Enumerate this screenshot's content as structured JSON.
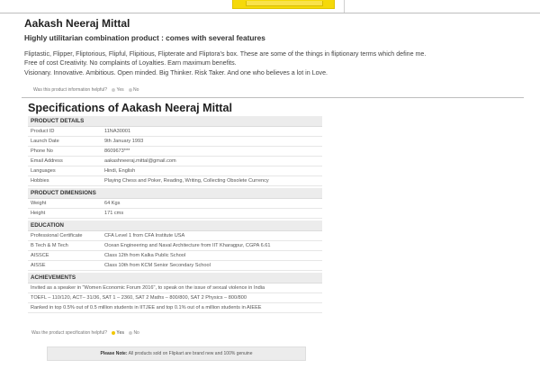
{
  "product": {
    "title": "Aakash Neeraj Mittal",
    "subtitle": "Highly utilitarian combination product : comes with several features",
    "description": [
      "Fliptastic, Flipper, Fliptorious, Flipful, Flipitious, Flipterate and Fliptora's box. These are some of the things in fliptionary terms which define me.",
      "Free of cost Creativity. No complaints of Loyalties. Earn maximum benefits.",
      "Visionary. Innovative. Ambitious. Open minded. Big Thinker. Risk Taker. And one who believes a lot in Love."
    ]
  },
  "helpful_info": {
    "question": "Was this product information helpful?",
    "yes": "Yes",
    "no": "No"
  },
  "specs": {
    "title": "Specifications of Aakash  Neeraj Mittal",
    "sections": [
      {
        "heading": "PRODUCT DETAILS",
        "rows": [
          {
            "label": "Product ID",
            "value": "11NA30001"
          },
          {
            "label": "Launch Date",
            "value": "9th January 1993"
          },
          {
            "label": "Phone No",
            "value": "8609673***"
          },
          {
            "label": "Email Address",
            "value": "aakashneeraj.mittal@gmail.com"
          },
          {
            "label": "Languages",
            "value": "Hindi, English"
          },
          {
            "label": "Hobbies",
            "value": "Playing Chess and Poker,  Reading, Writing, Collecting Obsolete Currency"
          }
        ]
      },
      {
        "heading": "PRODUCT DIMENSIONS",
        "rows": [
          {
            "label": "Weight",
            "value": "64 Kgs"
          },
          {
            "label": "Height",
            "value": "171 cms"
          }
        ]
      },
      {
        "heading": "EDUCATION",
        "rows": [
          {
            "label": "Professional Certificate",
            "value": "CFA Level 1 from CFA Institute USA"
          },
          {
            "label": "B Tech & M Tech",
            "value": "Ocean Engineering and Naval Architecture from IIT Kharagpur, CGPA 6.61"
          },
          {
            "label": "AISSCE",
            "value": "Class 12th from Kalka Public School"
          },
          {
            "label": "AISSE",
            "value": "Class 10th from KCM Senior Secondary School"
          }
        ]
      },
      {
        "heading": "ACHIEVEMENTS",
        "rows": [
          {
            "label": "",
            "value": "Invited as a speaker in \"Women Economic Forum 2016\", to speak on the issue of sexual violence in India"
          },
          {
            "label": "",
            "value": "TOEFL – 110/120, ACT– 31/36, SAT 1 – 2360, SAT 2 Maths – 800/800, SAT 2 Physics – 800/800"
          },
          {
            "label": "",
            "value": "Ranked in top 0.5% out of 0.5 million students in IITJEE and top 0.1% out of a million students in AIEEE"
          }
        ]
      }
    ]
  },
  "helpful_spec": {
    "question": "Was the product specification helpful?",
    "yes": "Yes",
    "no": "No"
  },
  "note": {
    "label": "Please Note:",
    "text": "All products sold on Flipkart are brand new and 100% genuine"
  },
  "colors": {
    "accent_yellow": "#f5d90a",
    "section_bg": "#ececec"
  }
}
